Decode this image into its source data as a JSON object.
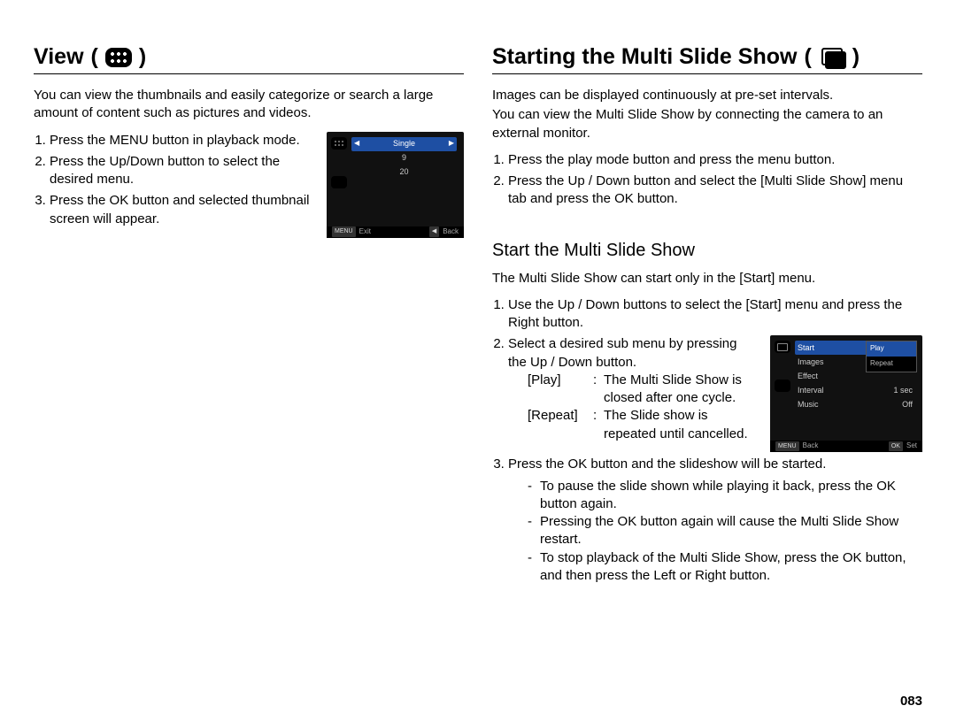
{
  "left": {
    "title": "View",
    "paren_open": "(",
    "paren_close": ")",
    "icon": "grid-thumbnails-icon",
    "intro": "You can view the thumbnails and easily categorize or search a large amount of content such as pictures and videos.",
    "steps": [
      "Press the MENU button in playback mode.",
      "Press the Up/Down button to select the desired menu.",
      "Press the OK button and selected thumbnail screen will appear."
    ],
    "lcd": {
      "rows": [
        "Single",
        "9",
        "20"
      ],
      "highlighted_index": 0,
      "footer_left_btn": "MENU",
      "footer_left": "Exit",
      "footer_right_btn": "◀",
      "footer_right": "Back"
    }
  },
  "right": {
    "title": "Starting the Multi Slide Show",
    "paren_open": "(",
    "paren_close": ")",
    "icon": "slideshow-stack-icon",
    "intro1": "Images can be displayed continuously at pre-set intervals.",
    "intro2": "You can view the Multi Slide Show by connecting the camera to an external monitor.",
    "steps1": [
      "Press the play mode button and press the menu button.",
      "Press the Up / Down button and select the [Multi Slide Show] menu tab and press the OK button."
    ],
    "sub_title": "Start the Multi Slide Show",
    "sub_intro": "The Multi Slide Show can start only in the [Start] menu.",
    "step2_1": "Use the Up / Down buttons to select the [Start] menu and press the Right button.",
    "step2_2": "Select a desired sub menu by pressing the Up / Down button.",
    "defs": [
      {
        "label": "[Play]",
        "value": "The Multi Slide Show is closed after one cycle."
      },
      {
        "label": "[Repeat]",
        "value": "The Slide show is repeated until cancelled."
      }
    ],
    "step2_3": "Press the OK button and the slideshow will be started.",
    "notes": [
      "To pause the slide shown while playing it back, press the OK button again.",
      "Pressing the OK button again will cause the Multi Slide Show restart.",
      "To stop playback of the Multi Slide Show, press the OK button, and then press the Left or Right button."
    ],
    "lcd": {
      "rows": [
        {
          "label": "Start",
          "value": ""
        },
        {
          "label": "Images",
          "value": ""
        },
        {
          "label": "Effect",
          "value": ""
        },
        {
          "label": "Interval",
          "value": "1 sec"
        },
        {
          "label": "Music",
          "value": "Off"
        }
      ],
      "highlighted_index": 0,
      "popup": [
        "Play",
        "Repeat"
      ],
      "popup_selected_index": 0,
      "footer_left_btn": "MENU",
      "footer_left": "Back",
      "footer_right_btn": "OK",
      "footer_right": "Set"
    }
  },
  "page_number": "083"
}
